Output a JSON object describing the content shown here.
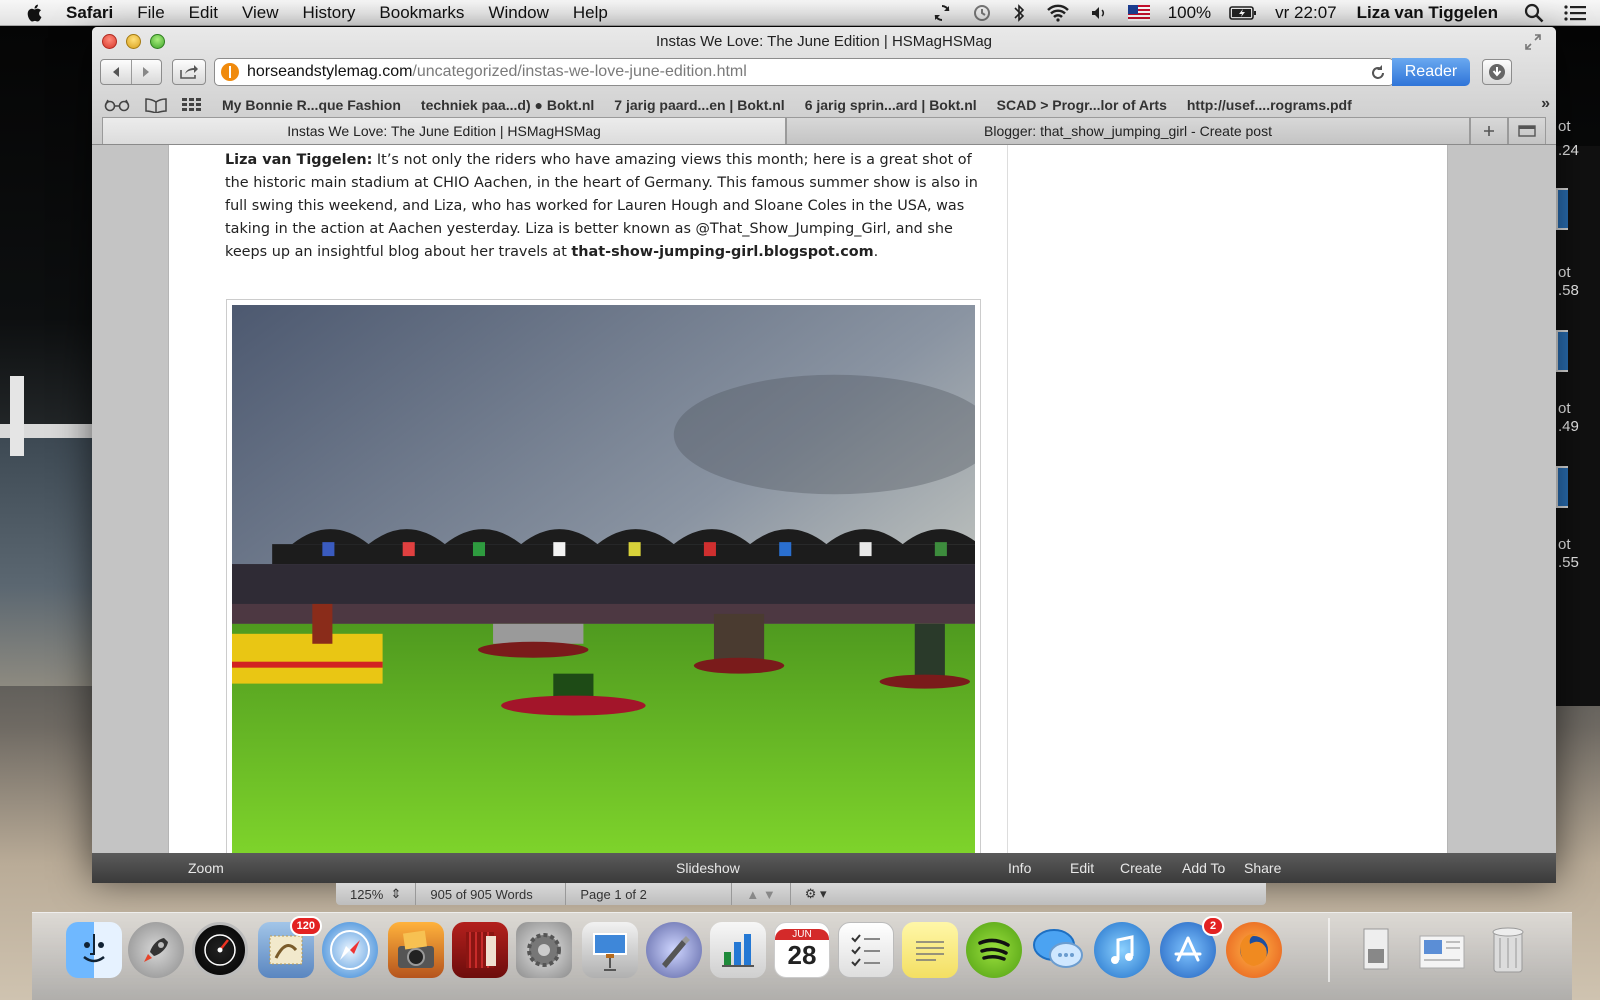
{
  "menubar": {
    "app": "Safari",
    "items": [
      "File",
      "Edit",
      "View",
      "History",
      "Bookmarks",
      "Window",
      "Help"
    ],
    "battery": "100%",
    "clock": "vr 22:07",
    "user": "Liza van Tiggelen"
  },
  "desktop": {
    "labels": [
      "ot",
      ".24",
      "ot",
      ".58",
      "ot",
      ".49",
      "ot",
      ".55"
    ]
  },
  "window": {
    "title": "Instas We Love: The June Edition | HSMagHSMag",
    "url_domain": "horseandstylemag.com",
    "url_path": "/uncategorized/instas-we-love-june-edition.html",
    "reader_label": "Reader",
    "bookmarks": [
      "My Bonnie R...que Fashion",
      "techniek paa...d) ● Bokt.nl",
      "7 jarig paard...en | Bokt.nl",
      "6 jarig sprin...ard | Bokt.nl",
      "SCAD > Progr...lor of Arts",
      "http://usef....rograms.pdf"
    ],
    "tabs": [
      "Instas We Love: The June Edition | HSMagHSMag",
      "Blogger: that_show_jumping_girl - Create post"
    ]
  },
  "article": {
    "author": "Liza van Tiggelen:",
    "body": " It’s not only the riders who have amazing views this month; here is a great shot of the historic main stadium at CHIO Aachen, in the heart of Germany. This famous summer show is also in full swing this weekend, and Liza, who has worked for Lauren Hough and Sloane Coles in the USA, was taking in the action at Aachen yesterday. Liza is better known as @That_Show_Jumping_Girl, and she keeps up an insightful blog about her travels at ",
    "blog_link": "that-show-jumping-girl.blogspot.com",
    "end": "."
  },
  "iphoto": {
    "zoom": "Zoom",
    "slideshow": "Slideshow",
    "info": "Info",
    "edit": "Edit",
    "create": "Create",
    "add_to": "Add To",
    "share": "Share",
    "zoom_level": "125%",
    "words": "905 of 905 Words",
    "page": "Page 1 of 2"
  },
  "dock": {
    "mail_badge": "120",
    "calendar_month": "JUN",
    "calendar_day": "28",
    "appstore_badge": "2"
  }
}
